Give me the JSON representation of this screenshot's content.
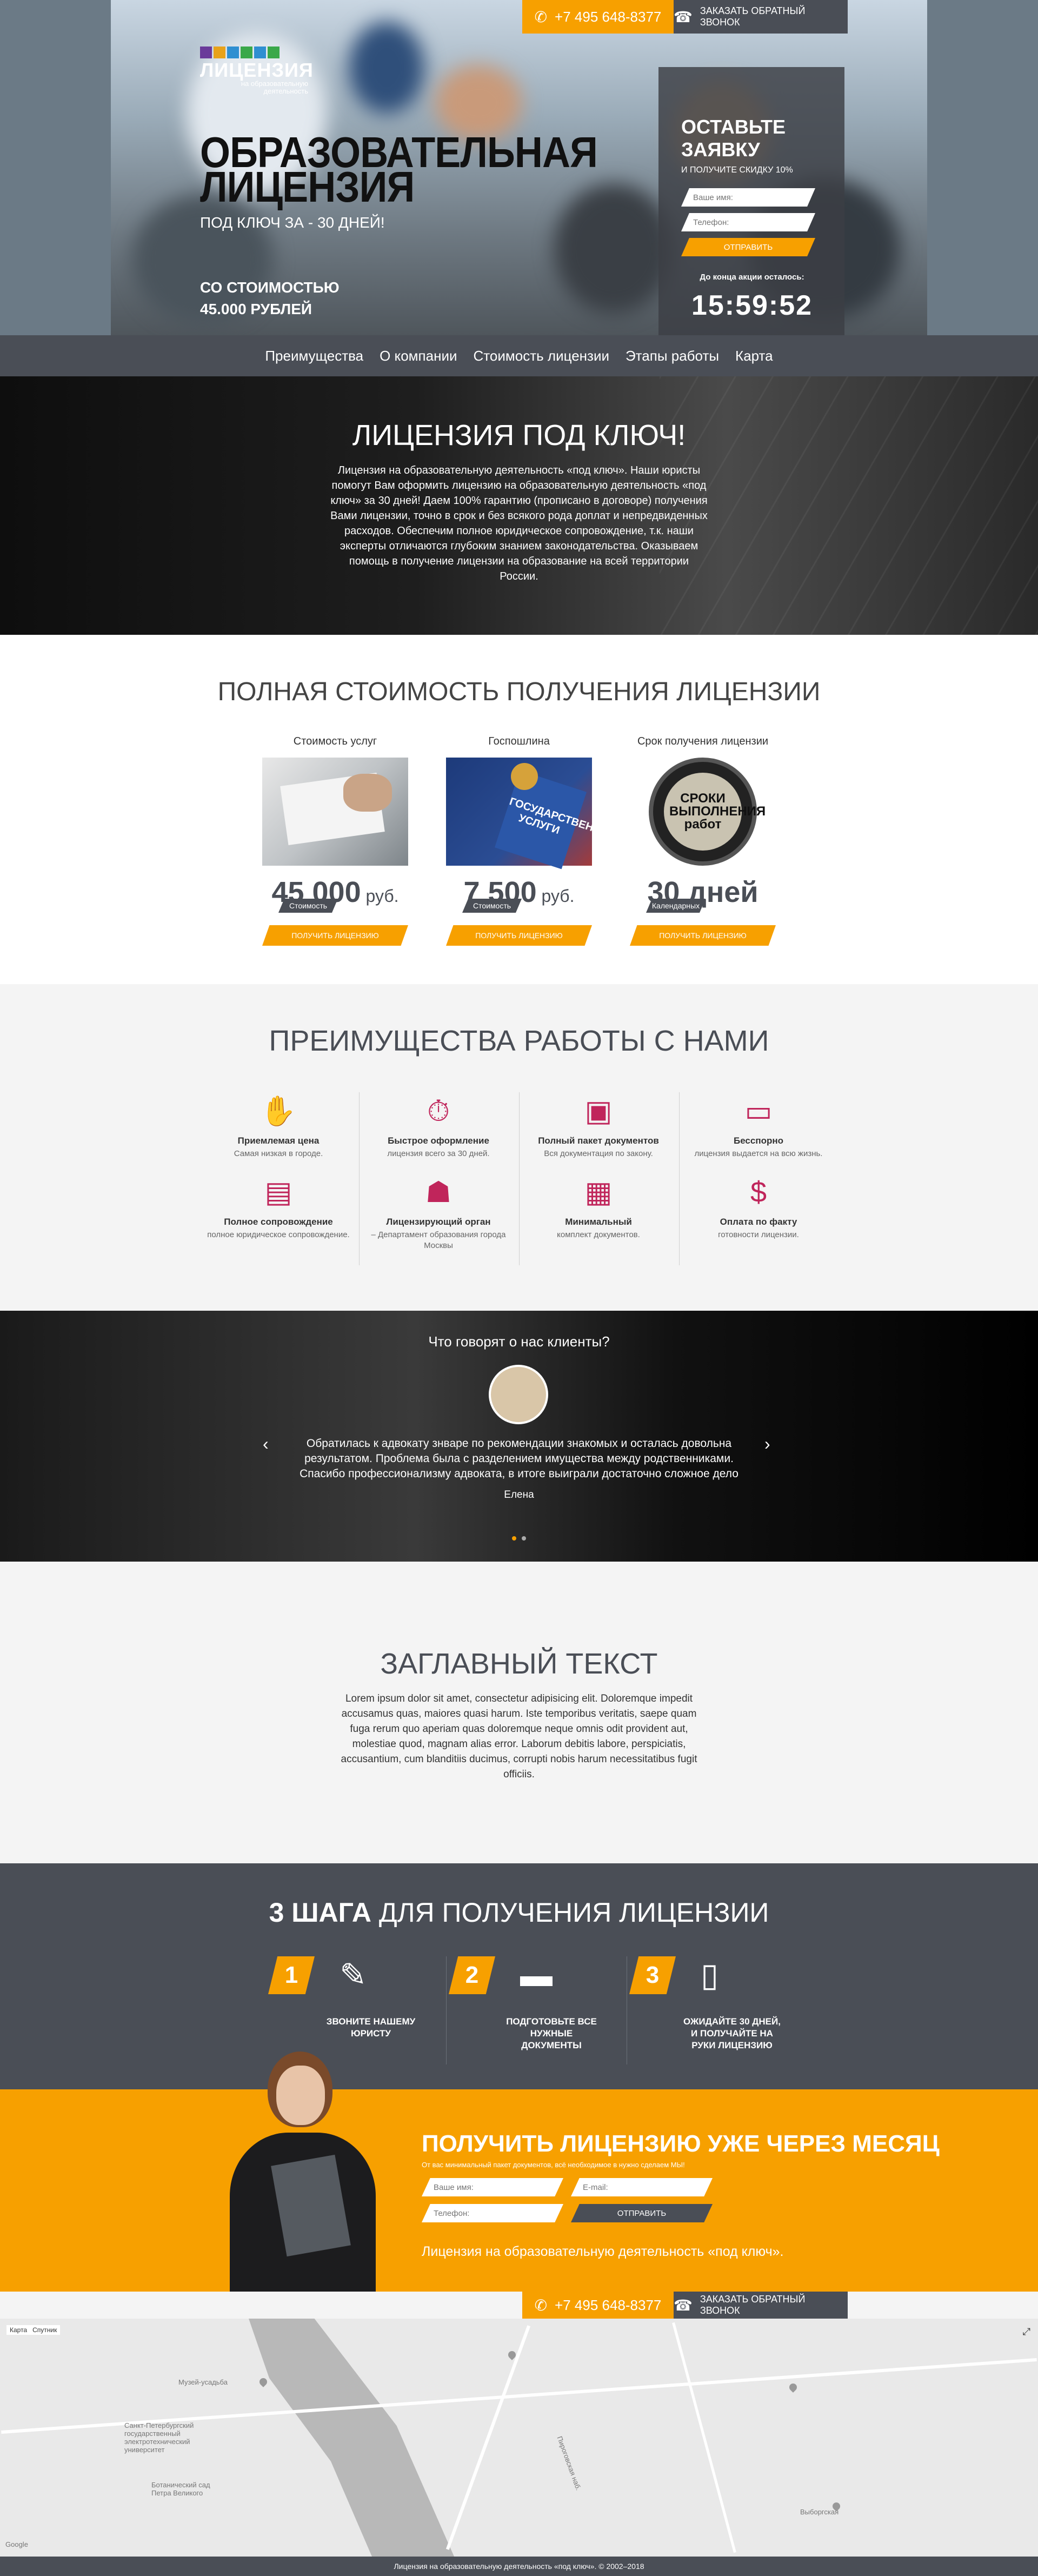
{
  "topbar": {
    "phone": "+7 495 648-8377",
    "callback": "ЗАКАЗАТЬ ОБРАТНЫЙ ЗВОНОК"
  },
  "brand": {
    "name": "ЛИЦЕНЗИЯ",
    "tagline": "на образовательную деятельность",
    "colors": [
      "#6a3a9a",
      "#e8a21a",
      "#2f8fd1",
      "#3aa84a"
    ]
  },
  "hero": {
    "title": "ОБРАЗОВАТЕЛЬНАЯ ЛИЦЕНЗИЯ",
    "subtitle": "ПОД КЛЮЧ ЗА - 30 ДНЕЙ!",
    "price": "СО СТОИМОСТЬЮ 45.000 РУБЛЕЙ"
  },
  "form": {
    "title": "ОСТАВЬТЕ ЗАЯВКУ",
    "subtitle": "И ПОЛУЧИТЕ СКИДКУ 10%",
    "name_placeholder": "Ваше имя:",
    "phone_placeholder": "Телефон:",
    "submit": "ОТПРАВИТЬ",
    "countdown_label": "До конца акции осталось:",
    "countdown": "15:59:52"
  },
  "nav": [
    "Преимущества",
    "О компании",
    "Стоимость лицензии",
    "Этапы работы",
    "Карта"
  ],
  "intro": {
    "title": "ЛИЦЕНЗИЯ ПОД КЛЮЧ!",
    "text": "Лицензия на образовательную деятельность «под ключ». Наши юристы помогут Вам оформить лицензию на образовательную деятельность «под ключ» за 30 дней! Даем 100% гарантию (прописано в договоре) получения Вами лицензии, точно в срок и без всякого рода доплат и непредвиденных расходов. Обеспечим полное юридическое сопровождение, т.к. наши эксперты отличаются глубоким знанием законодательства. Оказываем помощь в получение лицензии на образование на всей территории России."
  },
  "pricing": {
    "title": "ПОЛНАЯ СТОИМОСТЬ ПОЛУЧЕНИЯ ЛИЦЕНЗИИ",
    "cards": [
      {
        "caption": "Стоимость услуг",
        "tag": "Стоимость",
        "amount": "45 000",
        "unit": " руб.",
        "button": "ПОЛУЧИТЬ ЛИЦЕНЗИЮ"
      },
      {
        "caption": "Госпошлина",
        "tag": "Стоимость",
        "amount": "7 500",
        "unit": " руб.",
        "button": "ПОЛУЧИТЬ ЛИЦЕНЗИЮ",
        "image_text": "ГОСУДАРСТВЕННЫЕ УСЛУГИ"
      },
      {
        "caption": "Срок получения лицензии",
        "tag": "Календарных",
        "amount": "30 дней",
        "unit": "",
        "button": "ПОЛУЧИТЬ ЛИЦЕНЗИЮ",
        "image_text": "СРОКИ ВЫПОЛНЕНИЯ работ"
      }
    ]
  },
  "advantages": {
    "title": "ПРЕИМУЩЕСТВА РАБОТЫ С НАМИ",
    "accent": "#c0255b",
    "items": [
      {
        "title": "Приемлемая цена",
        "desc": "Самая низкая в городе.",
        "icon": "handshake-icon"
      },
      {
        "title": "Полное сопровождение",
        "desc": "полное юридическое сопровождение.",
        "icon": "certificate-icon"
      },
      {
        "title": "Быстрое оформление",
        "desc": "лицензия всего за 30 дней.",
        "icon": "stopwatch-icon"
      },
      {
        "title": "Лицензирующий орган",
        "desc": "– Департамент образования города Москвы",
        "icon": "agent-icon"
      },
      {
        "title": "Полный пакет документов",
        "desc": "Вся документация по закону.",
        "icon": "briefcase-icon"
      },
      {
        "title": "Минимальный",
        "desc": "комплект документов.",
        "icon": "document-icon"
      },
      {
        "title": "Бесспорно",
        "desc": "лицензия выдается на всю жизнь.",
        "icon": "monitor-icon"
      },
      {
        "title": "Оплата по факту",
        "desc": "готовности лицензии.",
        "icon": "money-bag-icon"
      }
    ]
  },
  "testimonials": {
    "title": "Что говорят о нас клиенты?",
    "quote": "Обратилась к адвокату знваре по рекомендации знакомых и осталась довольна результатом. Проблема была с разделением имущества между родственниками. Спасибо профессионализму адвоката, в итоге выиграли достаточно сложное дело",
    "author": "Елена"
  },
  "heading_text": {
    "title": "ЗАГЛАВНЫЙ ТЕКСТ",
    "text": "Lorem ipsum dolor sit amet, consectetur adipisicing elit. Doloremque impedit accusamus quas, maiores quasi harum. Iste temporibus veritatis, saepe quam fuga rerum quo aperiam quas doloremque neque omnis odit provident aut, molestiae quod, magnam alias error. Laborum debitis labore, perspiciatis, accusantium, cum blanditiis ducimus, corrupti nobis harum necessitatibus fugit officiis."
  },
  "steps": {
    "title_bold": "3 ШАГА",
    "title_rest": " ДЛЯ ПОЛУЧЕНИЯ ЛИЦЕНЗИИ",
    "items": [
      {
        "num": "1",
        "text": "ЗВОНИТЕ НАШЕМУ ЮРИСТУ",
        "icon": "pen-paper-icon"
      },
      {
        "num": "2",
        "text": "ПОДГОТОВЬТЕ ВСЕ НУЖНЫЕ ДОКУМЕНТЫ",
        "icon": "cards-icon"
      },
      {
        "num": "3",
        "text": "ОЖИДАЙТЕ 30 ДНЕЙ, И ПОЛУЧАЙТЕ НА РУКИ ЛИЦЕНЗИЮ",
        "icon": "license-icon"
      }
    ]
  },
  "cta": {
    "title": "ПОЛУЧИТЬ ЛИЦЕНЗИЮ УЖЕ ЧЕРЕЗ МЕСЯЦ",
    "subtitle": "От вас минимальный пакет документов, всё необходимое в нужно сделаем МЫ!",
    "name_placeholder": "Ваше имя:",
    "email_placeholder": "E-mail:",
    "phone_placeholder": "Телефон:",
    "submit": "ОТПРАВИТЬ",
    "footer_text": "Лицензия на образовательную деятельность «под ключ»."
  },
  "map": {
    "tabs": [
      "Карта",
      "Спутник"
    ],
    "labels": [
      "Санкт-Петербургский государственный электротехнический университет",
      "Музей-усадьба",
      "Выборгская",
      "Пироговская наб.",
      "Ботанический сад Петра Великого",
      "Google"
    ]
  },
  "footer": {
    "text": "Лицензия на образовательную деятельность «под ключ». © 2002–2018"
  }
}
